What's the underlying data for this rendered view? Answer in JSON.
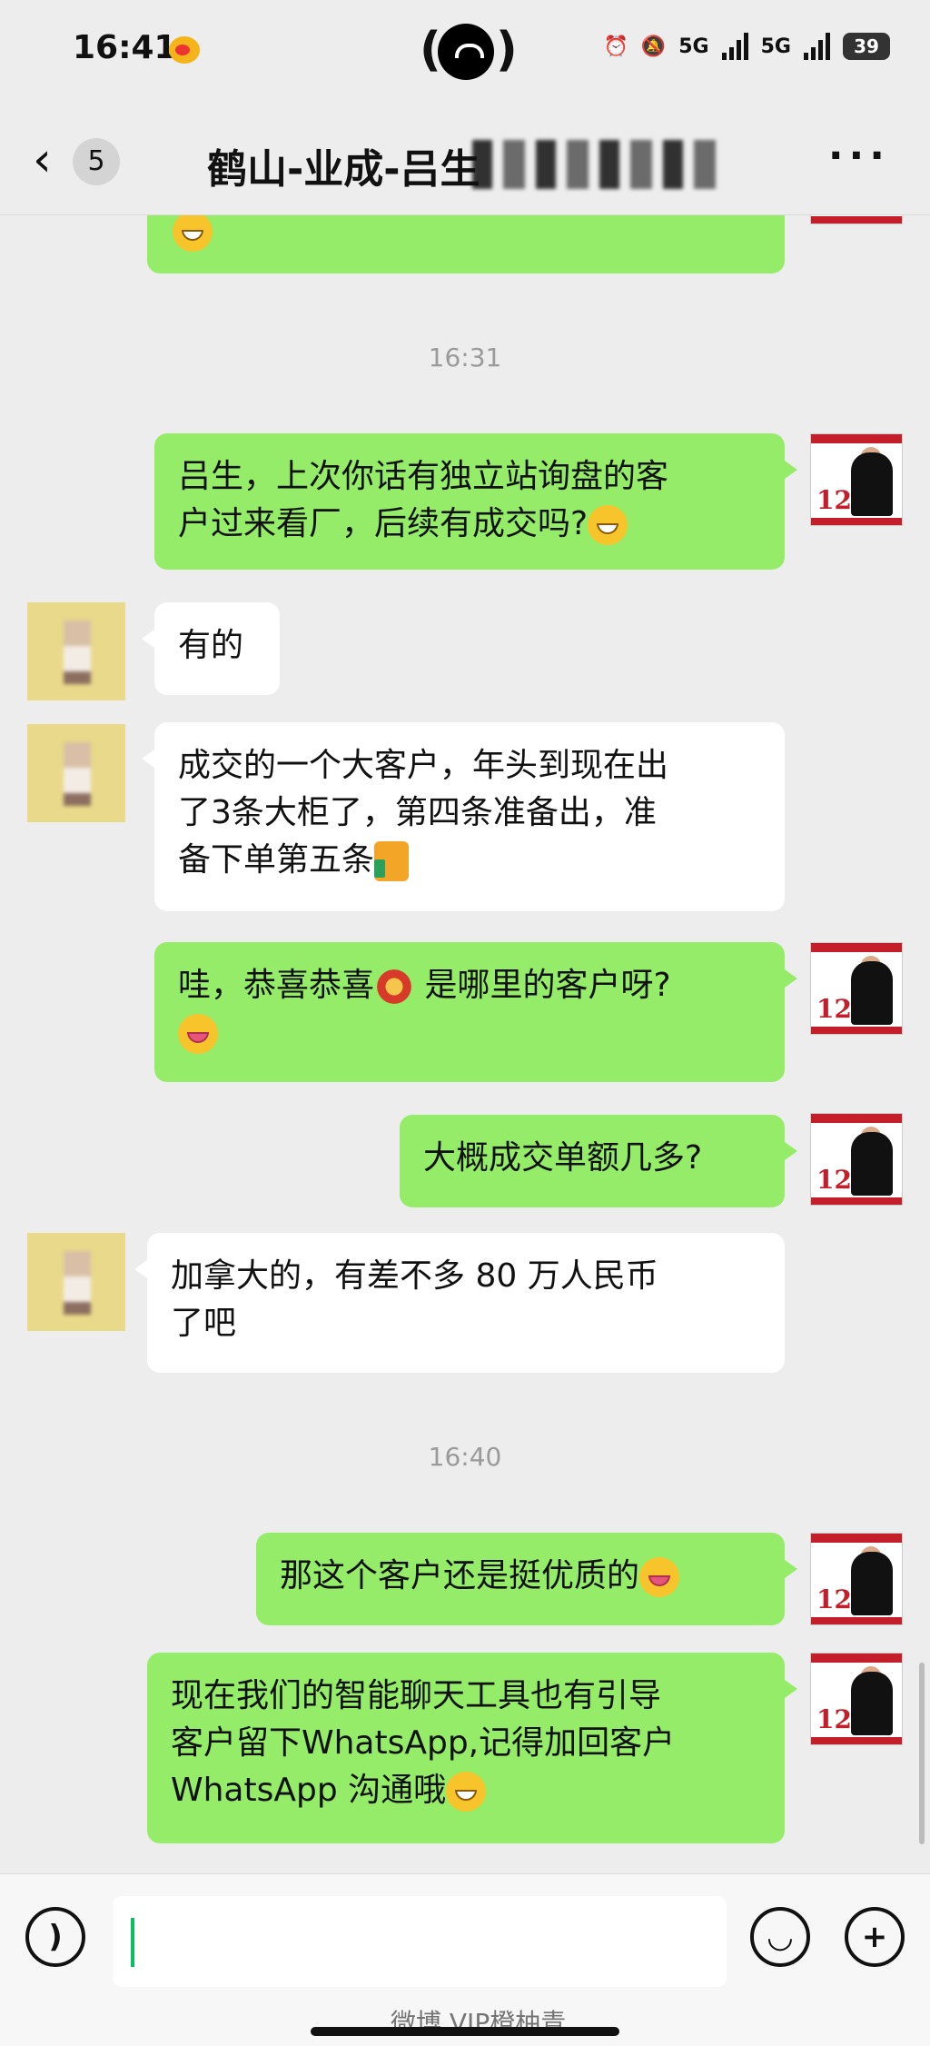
{
  "status_bar": {
    "time": "16:41",
    "network_1": "5G",
    "network_2": "5G",
    "battery": "39"
  },
  "header": {
    "back_icon": "chevron-left-icon",
    "unread_count": "5",
    "title": "鹤山-业成-吕生",
    "more_icon": "more-dots-icon"
  },
  "messages": {
    "ts1": "16:31",
    "m1_line1": "吕生，上次你话有独立站询盘的客",
    "m1_line2": "户过来看厂，后续有成交吗?",
    "m2": "有的",
    "m3_line1": "成交的一个大客户，年头到现在出",
    "m3_line2": "了3条大柜了，第四条准备出，准",
    "m3_line3": "备下单第五条",
    "m4_line1": "哇，恭喜恭喜",
    "m4_line1b": " 是哪里的客户呀?",
    "m5": "大概成交单额几多?",
    "m6_line1": "加拿大的，有差不多 80 万人民币",
    "m6_line2": "了吧",
    "ts2": "16:40",
    "m7": "那这个客户还是挺优质的",
    "m8_line1": "现在我们的智能聊天工具也有引导",
    "m8_line2": "客户留下WhatsApp,记得加回客户",
    "m8_line3": "WhatsApp 沟通哦"
  },
  "avatar_me_badge": "12",
  "input_bar": {
    "voice_icon": "voice-icon",
    "emoji_icon": "smile-icon",
    "plus_icon": "plus-icon",
    "plus_label": "+"
  },
  "watermark": "微博 VIP橙柚青"
}
